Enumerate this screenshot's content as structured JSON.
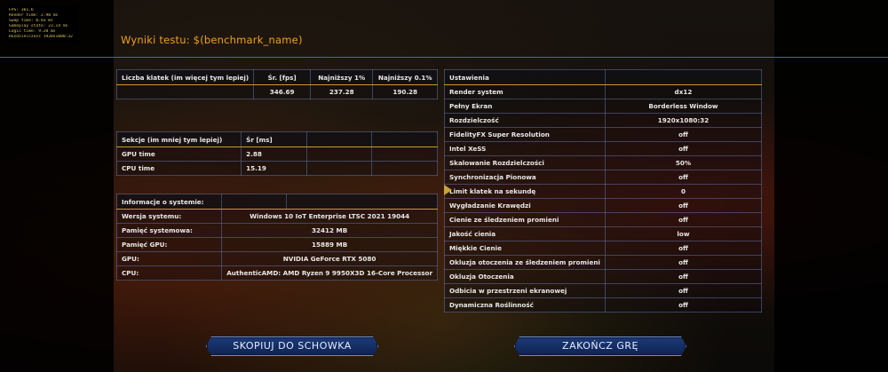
{
  "overlay": {
    "lines": [
      "FPS: 361.6",
      "Render time: 2.90 ms",
      "Swap time: 0.03 ms",
      "Gameplay state: 23.14 ms",
      "Logic time: 9.20 ms",
      "Rozdzielczość 1920x1080:32"
    ]
  },
  "title": "Wyniki testu: $(benchmark_name)",
  "fps_table": {
    "header": [
      "Liczba klatek (im więcej tym lepiej)",
      "Śr. [fps]",
      "Najniższy 1%",
      "Najniższy 0.1%"
    ],
    "row": [
      "",
      "346.69",
      "237.28",
      "190.28"
    ]
  },
  "sections_table": {
    "header": [
      "Sekcje (im mniej tym lepiej)",
      "Śr [ms]",
      "",
      ""
    ],
    "rows": [
      [
        "GPU time",
        "2.88",
        "",
        ""
      ],
      [
        "CPU time",
        "15.19",
        "",
        ""
      ]
    ]
  },
  "system_table": {
    "header": [
      "Informacje o systemie:",
      "",
      ""
    ],
    "rows": [
      [
        "Wersja systemu:",
        "Windows 10 IoT Enterprise LTSC 2021 19044"
      ],
      [
        "Pamięć systemowa:",
        "32412 MB"
      ],
      [
        "Pamięć GPU:",
        "15889 MB"
      ],
      [
        "GPU:",
        "NVIDIA GeForce RTX 5080"
      ],
      [
        "CPU:",
        "AuthenticAMD: AMD Ryzen 9 9950X3D 16-Core Processor"
      ]
    ]
  },
  "settings_table": {
    "header": [
      "Ustawienia",
      ""
    ],
    "rows": [
      [
        "Render system",
        "dx12"
      ],
      [
        "Pełny Ekran",
        "Borderless Window"
      ],
      [
        "Rozdzielczość",
        "1920x1080:32"
      ],
      [
        "FidelityFX Super Resolution",
        "off"
      ],
      [
        "Intel XeSS",
        "off"
      ],
      [
        "Skalowanie Rozdzielczości",
        "50%"
      ],
      [
        "Synchronizacja Pionowa",
        "off"
      ],
      [
        "Limit klatek na sekundę",
        "0"
      ],
      [
        "Wygładzanie Krawędzi",
        "off"
      ],
      [
        "Cienie ze śledzeniem promieni",
        "off"
      ],
      [
        "Jakość cienia",
        "low"
      ],
      [
        "Miękkie Cienie",
        "off"
      ],
      [
        "Okluzja otoczenia ze śledzeniem promieni",
        "off"
      ],
      [
        "Okluzja Otoczenia",
        "off"
      ],
      [
        "Odbicia w przestrzeni ekranowej",
        "off"
      ],
      [
        "Dynamiczna Roślinność",
        "off"
      ]
    ]
  },
  "buttons": {
    "copy": "SKOPIUJ DO SCHOWKA",
    "quit": "ZAKOŃCZ GRĘ"
  },
  "colors": {
    "title": "#f0a020",
    "accent_line": "#c99a2e",
    "button": "#1c3a78"
  }
}
